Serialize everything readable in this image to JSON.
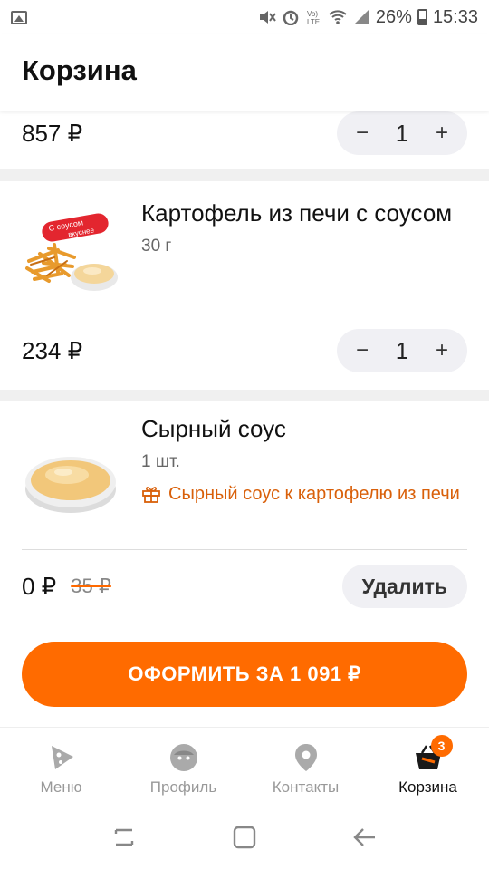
{
  "status": {
    "battery": "26%",
    "time": "15:33"
  },
  "header": {
    "title": "Корзина"
  },
  "items": [
    {
      "price": "857 ₽",
      "quantity": "1"
    },
    {
      "name": "Картофель из печи с соусом",
      "weight": "30 г",
      "image_badge_line1": "С соусом",
      "image_badge_line2": "вкуснее",
      "price": "234 ₽",
      "quantity": "1"
    },
    {
      "name": "Сырный соус",
      "weight": "1 шт.",
      "gift_text": "Сырный соус к картофелю из печи",
      "price": "0 ₽",
      "old_price": "35 ₽",
      "delete_label": "Удалить"
    }
  ],
  "stepper": {
    "minus": "−",
    "plus": "+"
  },
  "checkout": {
    "label": "ОФОРМИТЬ ЗА 1 091 ₽"
  },
  "tabs": [
    {
      "label": "Меню",
      "icon": "pizza-slice-icon"
    },
    {
      "label": "Профиль",
      "icon": "profile-face-icon"
    },
    {
      "label": "Контакты",
      "icon": "location-pin-icon"
    },
    {
      "label": "Корзина",
      "icon": "basket-icon",
      "badge": "3",
      "active": true
    }
  ],
  "colors": {
    "accent": "#ff6b00",
    "gift_text": "#d9600a"
  }
}
